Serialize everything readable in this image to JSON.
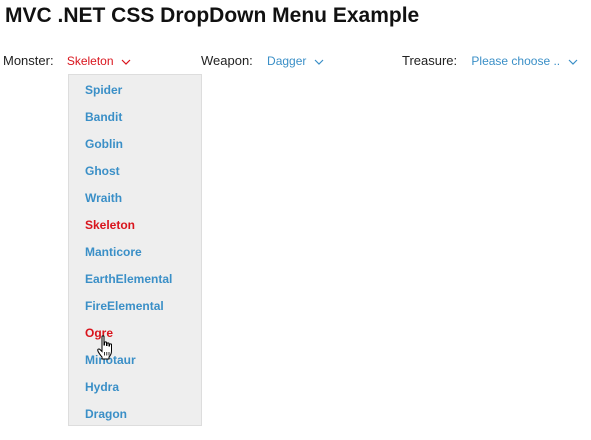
{
  "page": {
    "title": "MVC .NET CSS DropDown Menu Example"
  },
  "colors": {
    "link": "#3a8fc7",
    "selected": "#d9141c",
    "menu_bg": "#eeeeee"
  },
  "fields": {
    "monster": {
      "label": "Monster:",
      "value": "Skeleton",
      "icon": "chevron-down-icon"
    },
    "weapon": {
      "label": "Weapon:",
      "value": "Dagger",
      "icon": "chevron-down-icon"
    },
    "treasure": {
      "label": "Treasure:",
      "value": "Please choose ..",
      "icon": "chevron-down-icon"
    }
  },
  "monster_menu": {
    "items": [
      {
        "label": "Spider",
        "state": "normal"
      },
      {
        "label": "Bandit",
        "state": "normal"
      },
      {
        "label": "Goblin",
        "state": "normal"
      },
      {
        "label": "Ghost",
        "state": "normal"
      },
      {
        "label": "Wraith",
        "state": "normal"
      },
      {
        "label": "Skeleton",
        "state": "selected"
      },
      {
        "label": "Manticore",
        "state": "normal"
      },
      {
        "label": "EarthElemental",
        "state": "normal"
      },
      {
        "label": "FireElemental",
        "state": "normal"
      },
      {
        "label": "Ogre",
        "state": "hover"
      },
      {
        "label": "Minotaur",
        "state": "normal"
      },
      {
        "label": "Hydra",
        "state": "normal"
      },
      {
        "label": "Dragon",
        "state": "normal"
      }
    ]
  },
  "cursor": {
    "icon": "hand-pointer-icon"
  }
}
